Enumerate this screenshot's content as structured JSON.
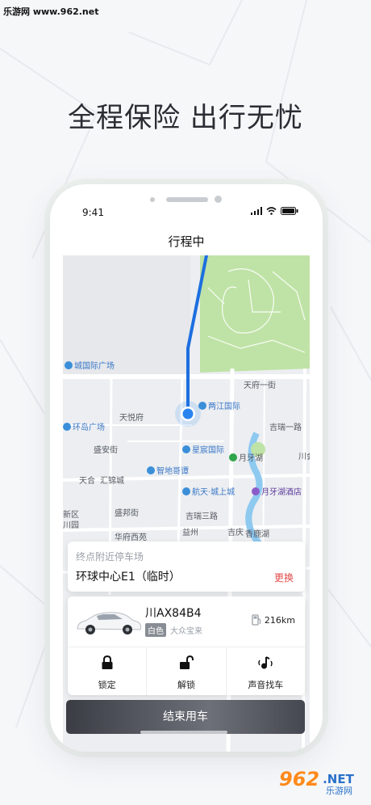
{
  "watermark": {
    "top_left": "乐游网 www.962.net",
    "bottom_right_logo": "962",
    "bottom_right_net": ".NET",
    "bottom_right_sub": "乐游网"
  },
  "headline": "全程保险 出行无忧",
  "status_bar": {
    "time": "9:41"
  },
  "nav": {
    "title": "行程中"
  },
  "map": {
    "labels": {
      "l1": "城国际广场",
      "l2": "天府一街",
      "l3": "天悦府",
      "l4": "两江国际",
      "l5": "环岛广场",
      "l6": "吉瑞一路",
      "l7": "盛安街",
      "l8": "月牙湖",
      "l9": "星宸国际",
      "l10": "天合",
      "l11": "汇锦城",
      "l12": "智地哥谭",
      "l13": "川会",
      "l14": "航天·城上城",
      "l15": "月牙湖酒店",
      "l16": "新区",
      "l17": "川园",
      "l18": "盛邦街",
      "l19": "吉瑞三路",
      "l20": "华府西苑",
      "l21": "益州",
      "l22": "吉庆",
      "l23": "香鹿湖"
    }
  },
  "parking": {
    "caption": "终点附近停车场",
    "name": "环球中心E1（临时）",
    "change": "更换"
  },
  "car": {
    "plate": "川AX84B4",
    "color": "白色",
    "model": "大众宝来",
    "range": "216km"
  },
  "actions": [
    {
      "label": "锁定",
      "icon": "lock-icon"
    },
    {
      "label": "解锁",
      "icon": "unlock-icon"
    },
    {
      "label": "声音找车",
      "icon": "sound-find-car-icon"
    }
  ],
  "end_button": "结束用车",
  "colors": {
    "route": "#1e6fe0",
    "location": "#2a84f0",
    "park": "#bfe3a6",
    "water": "#8ec9f0",
    "danger": "#e24a4a"
  }
}
